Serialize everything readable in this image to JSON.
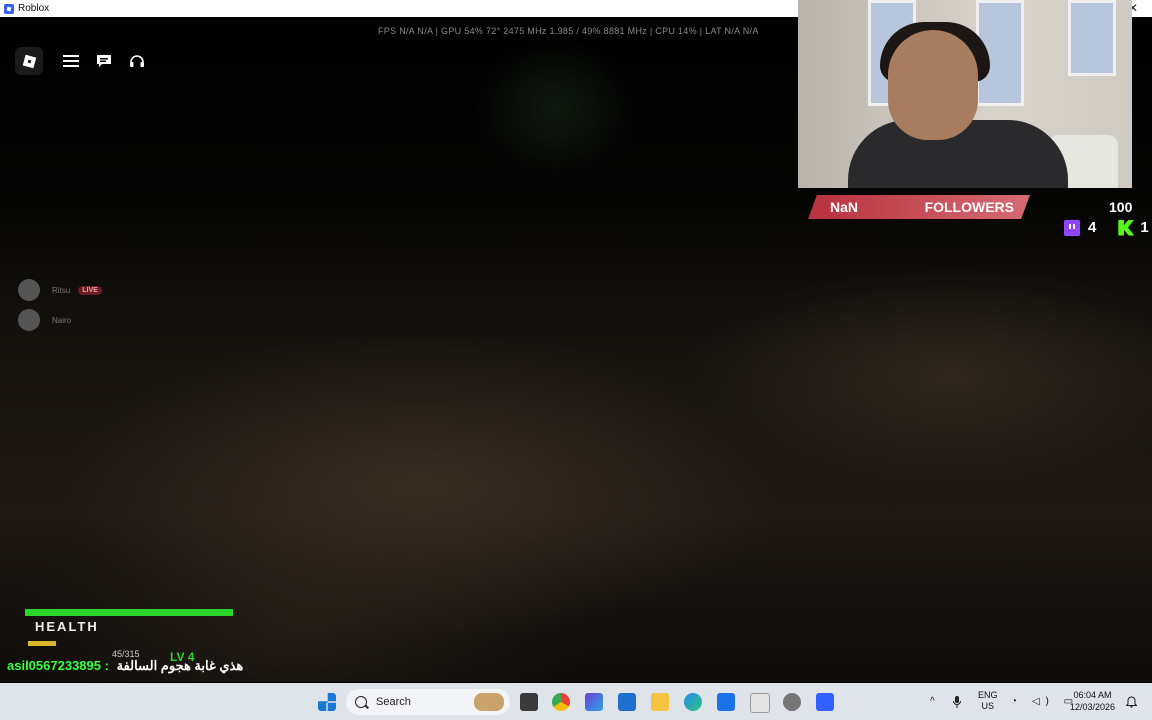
{
  "window": {
    "title": "Roblox",
    "close_glyph": "✕"
  },
  "game": {
    "stats_bar": "FPS  N/A  N/A  |  GPU  54%  72°  2475 MHz  1.985 / 49%  8881 MHz  |  CPU  14%  |  LAT  N/A  N/A",
    "players": [
      {
        "name": "Ritsu",
        "badge": "LIVE"
      },
      {
        "name": "Nairo",
        "badge": ""
      }
    ],
    "hud": {
      "health_label": "HEALTH",
      "health_fraction": 1.0,
      "xp_text": "45/315",
      "level_text": "LV  4"
    },
    "chat": {
      "user": "asil0567233895 :",
      "message": "هذي غابة هجوم السالفة"
    }
  },
  "stream_overlay": {
    "followers_current": "NaN",
    "followers_label": "FOLLOWERS",
    "followers_goal": "100",
    "twitch_count": "4",
    "kick_count": "1"
  },
  "taskbar": {
    "search_placeholder": "Search",
    "tray_chevron": "^",
    "lang_top": "ENG",
    "lang_bottom": "US",
    "time": "06:04 AM",
    "date": "12/03/2026",
    "sys_icons": "◔ ◁) ▭"
  }
}
